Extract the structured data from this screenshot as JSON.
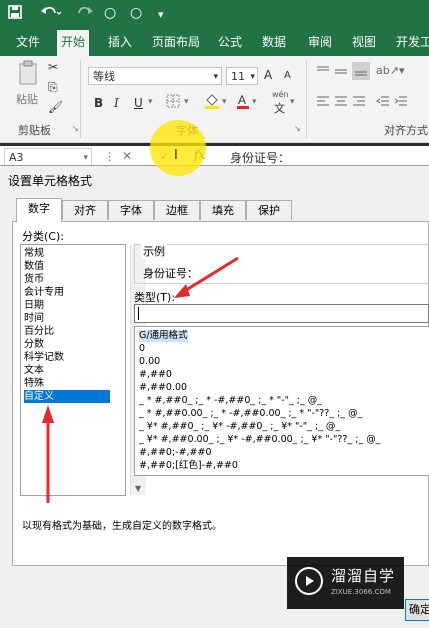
{
  "quick_access": {
    "save_icon": "save-icon",
    "undo_icon": "undo-icon",
    "redo_icon": "redo-icon",
    "circle1": "○",
    "circle2": "○"
  },
  "ribbon_tabs": [
    "文件",
    "开始",
    "插入",
    "页面布局",
    "公式",
    "数据",
    "审阅",
    "视图",
    "开发工"
  ],
  "active_tab": "开始",
  "clipboard": {
    "paste_label": "粘贴",
    "group_label": "剪贴板"
  },
  "font": {
    "name": "等线",
    "size": "11",
    "grow": "A",
    "shrink": "A",
    "bold": "B",
    "italic": "I",
    "underline": "U",
    "group_label": "字体",
    "wen": "wén"
  },
  "alignment": {
    "group_label": "对齐方式"
  },
  "formula_bar": {
    "name_box": "A3",
    "fx": "fx",
    "content": "身份证号："
  },
  "dialog": {
    "title": "设置单元格格式",
    "tabs": [
      "数字",
      "对齐",
      "字体",
      "边框",
      "填充",
      "保护"
    ],
    "active_tab": "数字",
    "category_label": "分类(C):",
    "categories": [
      "常规",
      "数值",
      "货币",
      "会计专用",
      "日期",
      "时间",
      "百分比",
      "分数",
      "科学记数",
      "文本",
      "特殊",
      "自定义"
    ],
    "selected_category": "自定义",
    "sample_label": "示例",
    "sample_value": "身份证号：",
    "type_label": "类型(T):",
    "type_value": "",
    "formats": [
      "G/通用格式",
      "0",
      "0.00",
      "#,##0",
      "#,##0.00",
      "_ * #,##0_ ;_ * -#,##0_ ;_ * \"-\"_ ;_ @_",
      "_ * #,##0.00_ ;_ * -#,##0.00_ ;_ * \"-\"??_ ;_ @_",
      "_ ¥* #,##0_ ;_ ¥* -#,##0_ ;_ ¥* \"-\"_ ;_ @_",
      "_ ¥* #,##0.00_ ;_ ¥* -#,##0.00_ ;_ ¥* \"-\"??_ ;_ @_",
      "#,##0;-#,##0",
      "#,##0;[红色]-#,##0"
    ],
    "description": "以现有格式为基础，生成自定义的数字格式。",
    "ok_label": "确定"
  },
  "watermark": {
    "name": "溜溜自学",
    "url": "ZIXUE.3066.COM"
  },
  "colors": {
    "excel_green": "#217346",
    "highlight": "#ffe600",
    "arrow_red": "#e8262b",
    "selection": "#0078d7"
  }
}
